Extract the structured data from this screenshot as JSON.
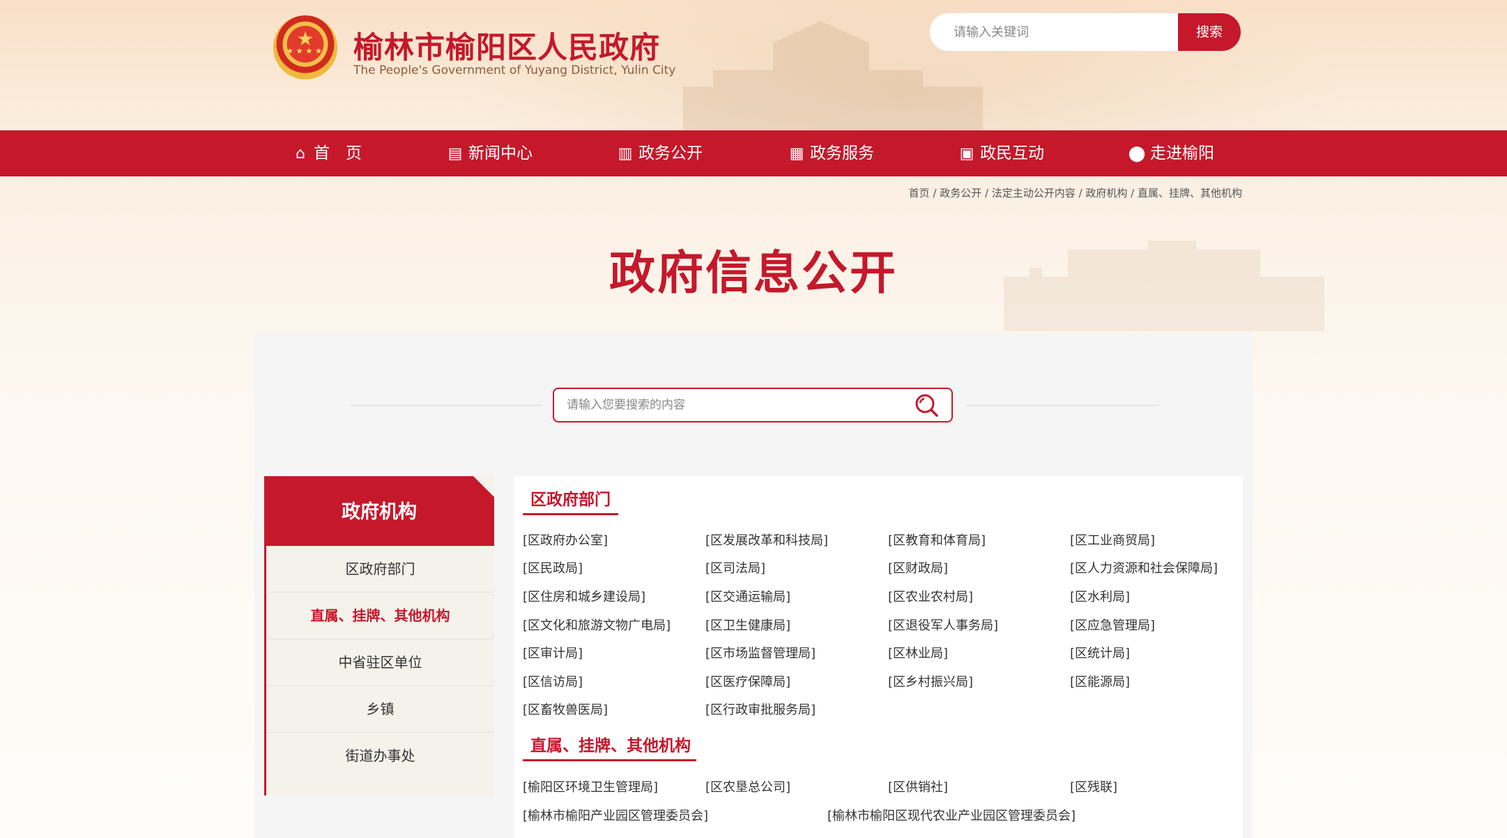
{
  "header": {
    "title": "榆林市榆阳区人民政府",
    "subtitle": "The People's Government of Yuyang District, Yulin City",
    "search_placeholder": "请输入关键词",
    "search_button": "搜索"
  },
  "nav": [
    {
      "label": "首　页",
      "icon": "home-icon"
    },
    {
      "label": "新闻中心",
      "icon": "news-icon"
    },
    {
      "label": "政务公开",
      "icon": "book-icon"
    },
    {
      "label": "政务服务",
      "icon": "grid-icon"
    },
    {
      "label": "政民互动",
      "icon": "chat-icon"
    },
    {
      "label": "走进榆阳",
      "icon": "location-pin-icon"
    }
  ],
  "breadcrumb": "首页 / 政务公开 / 法定主动公开内容 / 政府机构 / 直属、挂牌、其他机构",
  "page_title": "政府信息公开",
  "content_search": {
    "placeholder": "请输入您要搜索的内容"
  },
  "sidebar": {
    "header": "政府机构",
    "items": [
      "区政府部门",
      "直属、挂牌、其他机构",
      "中省驻区单位",
      "乡镇",
      "街道办事处"
    ],
    "active_index": 1
  },
  "sections": [
    {
      "title": "区政府部门",
      "items": [
        "[区政府办公室]",
        "[区发展改革和科技局]",
        "[区教育和体育局]",
        "[区工业商贸局]",
        "[区民政局]",
        "[区司法局]",
        "[区财政局]",
        "[区人力资源和社会保障局]",
        "[区住房和城乡建设局]",
        "[区交通运输局]",
        "[区农业农村局]",
        "[区水利局]",
        "[区文化和旅游文物广电局]",
        "[区卫生健康局]",
        "[区退役军人事务局]",
        "[区应急管理局]",
        "[区审计局]",
        "[区市场监督管理局]",
        "[区林业局]",
        "[区统计局]",
        "[区信访局]",
        "[区医疗保障局]",
        "[区乡村振兴局]",
        "[区能源局]",
        "[区畜牧兽医局]",
        "[区行政审批服务局]"
      ]
    },
    {
      "title": "直属、挂牌、其他机构",
      "items": [
        "[榆阳区环境卫生管理局]",
        "[区农垦总公司]",
        "[区供销社]",
        "[区残联]",
        "[榆林市榆阳产业园区管理委员会]",
        "[榆林市榆阳区现代农业产业园区管理委员会]"
      ]
    }
  ],
  "colors": {
    "accent": "#c5182b",
    "sidebar_bg": "#f5f1eb",
    "card_bg": "#f5f5f5"
  }
}
